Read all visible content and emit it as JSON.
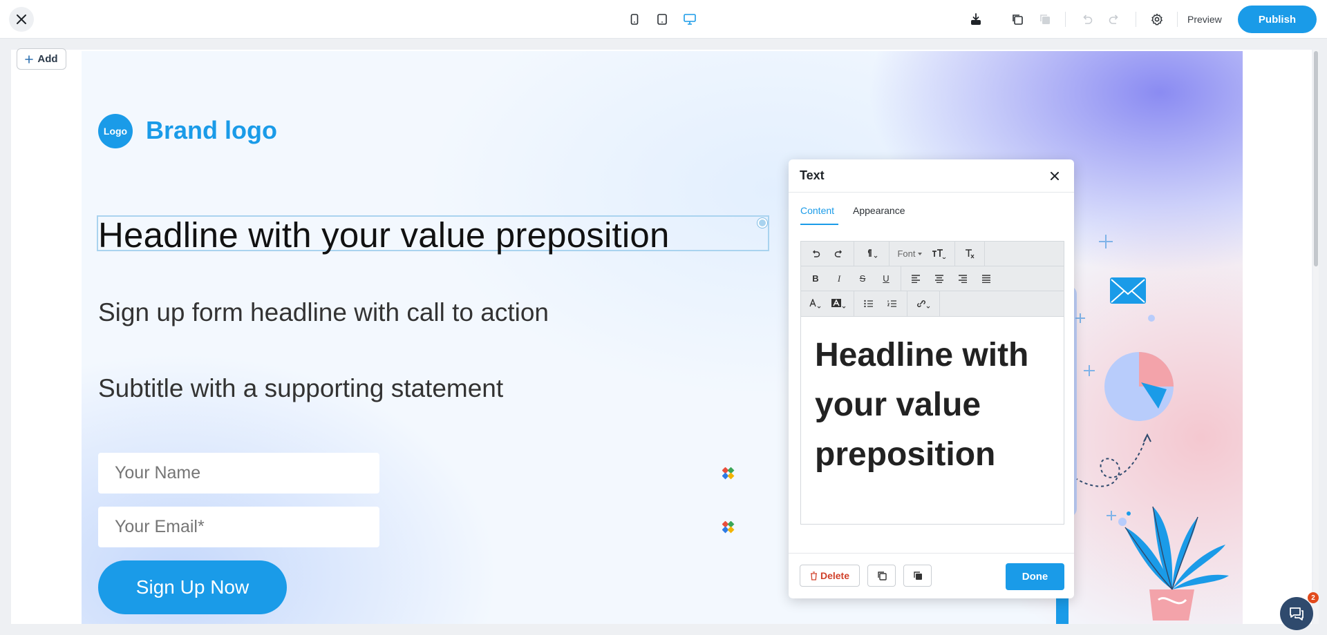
{
  "topbar": {
    "close_icon": "close-icon",
    "devices": [
      "phone-icon",
      "tablet-icon",
      "desktop-icon"
    ],
    "active_device": "desktop",
    "preview_label": "Preview",
    "publish_label": "Publish",
    "accent": "#1a9be8"
  },
  "canvas": {
    "add_label": "Add"
  },
  "page": {
    "logo_badge": "Logo",
    "brand_name": "Brand logo",
    "headline": "Headline with your value preposition",
    "subhead": "Sign up form headline with call to action",
    "subtitle": "Subtitle with a supporting statement",
    "name_placeholder": "Your Name",
    "email_placeholder": "Your Email*",
    "cta_label": "Sign Up Now"
  },
  "panel": {
    "title": "Text",
    "tabs": [
      {
        "label": "Content",
        "active": true
      },
      {
        "label": "Appearance",
        "active": false
      }
    ],
    "font_label": "Font",
    "editor_text": "Headline with your value preposition",
    "delete_label": "Delete",
    "done_label": "Done"
  },
  "chat": {
    "badge_count": "2"
  }
}
